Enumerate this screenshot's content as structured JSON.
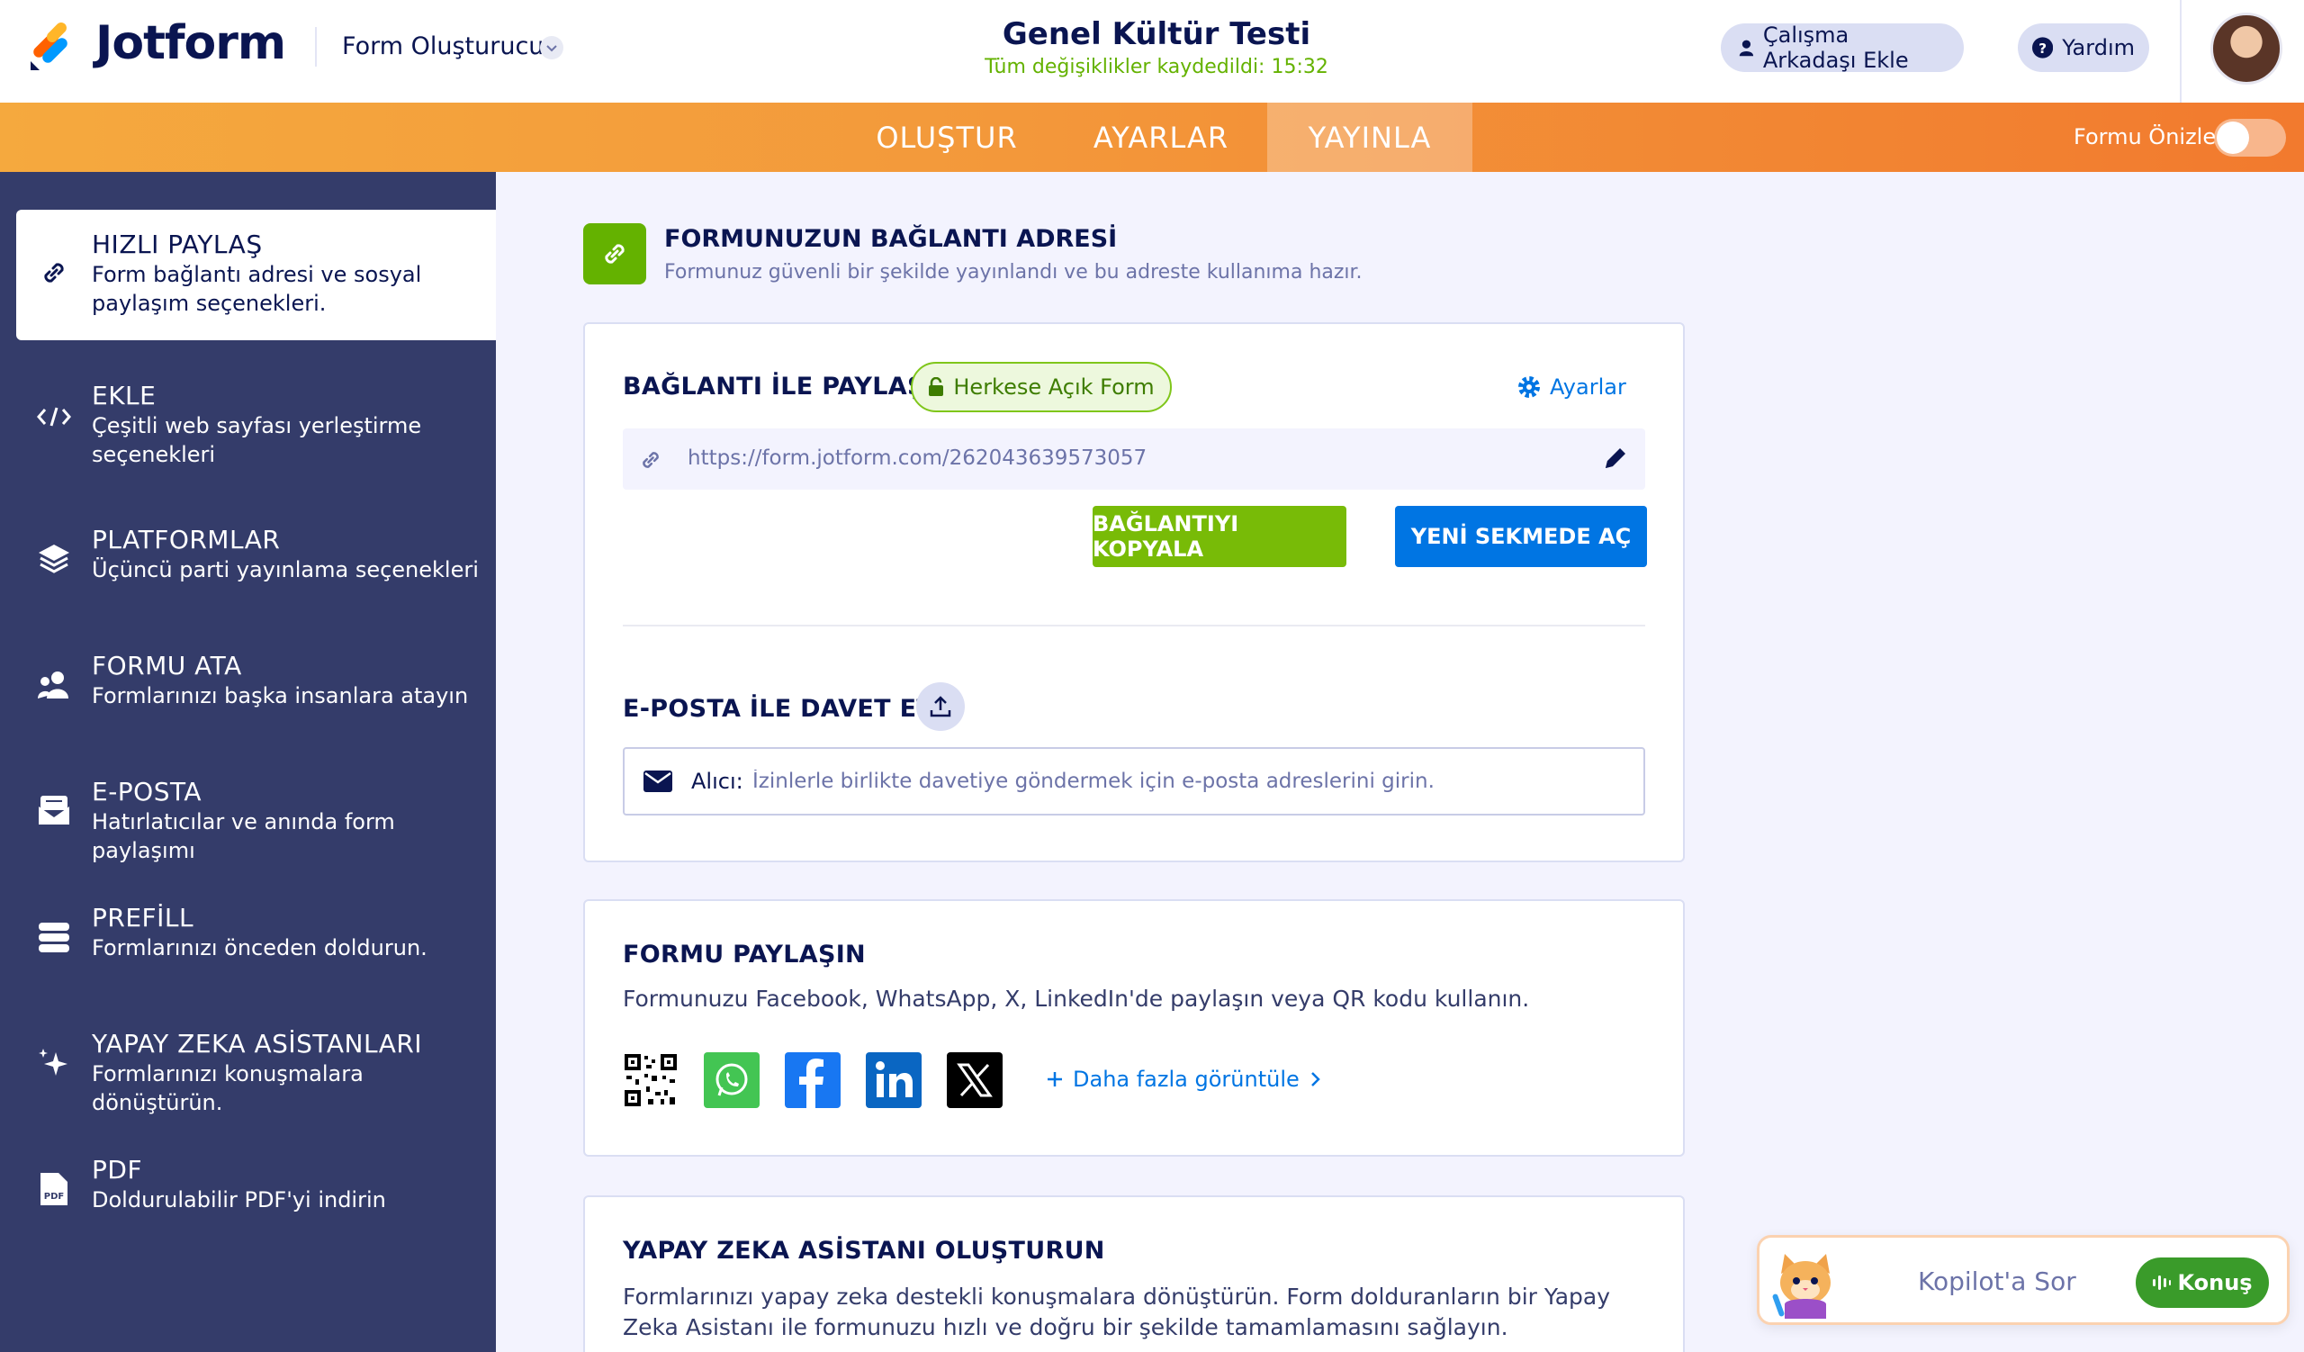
{
  "header": {
    "brand": "Jotform",
    "builder_label": "Form Oluşturucu",
    "form_title": "Genel Kültür Testi",
    "save_status": "Tüm değişiklikler kaydedildi: 15:32",
    "collab_button": "Çalışma Arkadaşı Ekle",
    "help_button": "Yardım"
  },
  "nav": {
    "tabs": [
      "OLUŞTUR",
      "AYARLAR",
      "YAYINLA"
    ],
    "active_tab": "YAYINLA",
    "preview_label": "Formu Önizle",
    "preview_enabled": false
  },
  "sidebar": {
    "items": [
      {
        "title": "HIZLI PAYLAŞ",
        "desc": "Form bağlantı adresi ve sosyal paylaşım seçenekleri.",
        "icon": "link-icon",
        "active": true
      },
      {
        "title": "EKLE",
        "desc": "Çeşitli web sayfası yerleştirme seçenekleri",
        "icon": "code-icon"
      },
      {
        "title": "PLATFORMLAR",
        "desc": "Üçüncü parti yayınlama seçenekleri",
        "icon": "layers-icon"
      },
      {
        "title": "FORMU ATA",
        "desc": "Formlarınızı başka insanlara atayın",
        "icon": "users-icon"
      },
      {
        "title": "E-POSTA",
        "desc": "Hatırlatıcılar ve anında form paylaşımı",
        "icon": "mail-icon"
      },
      {
        "title": "PREFİLL",
        "desc": "Formlarınızı önceden doldurun.",
        "icon": "prefill-icon"
      },
      {
        "title": "YAPAY ZEKA ASİSTANLARI",
        "desc": "Formlarınızı konuşmalara dönüştürün.",
        "icon": "sparkle-icon"
      },
      {
        "title": "PDF",
        "desc": "Doldurulabilir PDF'yi indirin",
        "icon": "pdf-icon"
      }
    ]
  },
  "section": {
    "title": "FORMUNUZUN BAĞLANTI ADRESİ",
    "subtitle": "Formunuz güvenli bir şekilde yayınlandı ve bu adreste kullanıma hazır."
  },
  "link_card": {
    "heading": "BAĞLANTI İLE PAYLAŞ",
    "badge": "Herkese Açık Form",
    "settings": "Ayarlar",
    "url": "https://form.jotform.com/262043639573057",
    "copy_button": "BAĞLANTIYI KOPYALA",
    "open_button": "YENİ SEKMEDE AÇ",
    "email_heading": "E-POSTA İLE DAVET ET",
    "email_label": "Alıcı:",
    "email_placeholder": "İzinlerle birlikte davetiye göndermek için e-posta adreslerini girin."
  },
  "share_card": {
    "heading": "FORMU PAYLAŞIN",
    "desc": "Formunuzu Facebook, WhatsApp, X, LinkedIn'de paylaşın veya QR kodu kullanın.",
    "more": "Daha fazla görüntüle",
    "colors": {
      "whatsapp": "#43c553",
      "facebook": "#1877f2",
      "linkedin": "#0a66c2",
      "x": "#000000"
    }
  },
  "ai_card": {
    "heading": "YAPAY ZEKA ASİSTANI OLUŞTURUN",
    "desc": "Formlarınızı yapay zeka destekli konuşmalara dönüştürün. Form dolduranların bir Yapay Zeka Asistanı ile formunuzu hızlı ve doğru bir şekilde tamamlamasını sağlayın."
  },
  "copilot": {
    "prompt": "Kopilot'a Sor",
    "talk_button": "Konuş"
  }
}
